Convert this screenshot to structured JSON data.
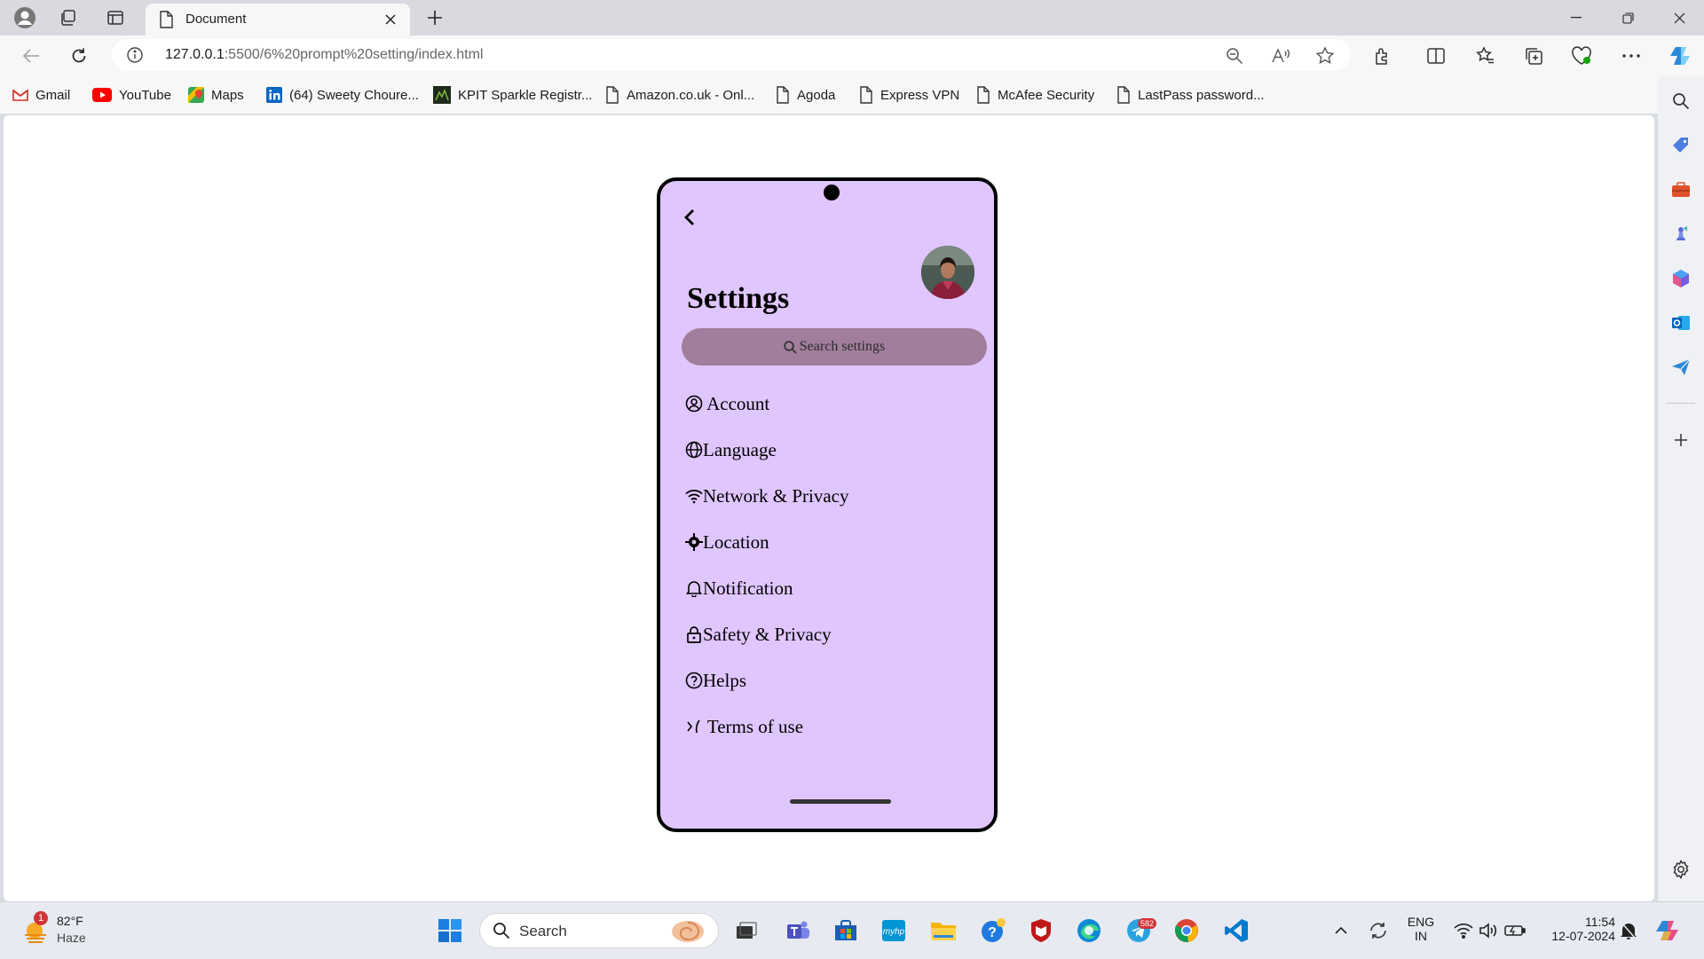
{
  "browser": {
    "tab_title": "Document",
    "url_host": "127.0.0.1",
    "url_rest": ":5500/6%20prompt%20setting/index.html"
  },
  "bookmarks": [
    {
      "label": "Gmail",
      "icon": "gmail-icon"
    },
    {
      "label": "YouTube",
      "icon": "youtube-icon"
    },
    {
      "label": "Maps",
      "icon": "maps-icon"
    },
    {
      "label": "(64) Sweety Choure...",
      "icon": "linkedin-icon"
    },
    {
      "label": "KPIT Sparkle Registr...",
      "icon": "kpit-icon"
    },
    {
      "label": "Amazon.co.uk - Onl...",
      "icon": "page-icon"
    },
    {
      "label": "Agoda",
      "icon": "page-icon"
    },
    {
      "label": "Express VPN",
      "icon": "page-icon"
    },
    {
      "label": "McAfee Security",
      "icon": "page-icon"
    },
    {
      "label": "LastPass password...",
      "icon": "page-icon"
    }
  ],
  "app": {
    "title": "Settings",
    "search_placeholder": "Search settings",
    "menu": [
      {
        "label": " Account",
        "icon": "account-circle-icon"
      },
      {
        "label": "Language",
        "icon": "globe-icon"
      },
      {
        "label": "Network & Privacy",
        "icon": "wifi-icon"
      },
      {
        "label": "Location",
        "icon": "location-crosshair-icon"
      },
      {
        "label": "Notification",
        "icon": "bell-icon"
      },
      {
        "label": "Safety & Privacy",
        "icon": "lock-icon"
      },
      {
        "label": "Helps",
        "icon": "help-circle-icon"
      },
      {
        "label": " Terms of use",
        "icon": "terms-icon"
      }
    ],
    "colors": {
      "phone_bg": "#e0c6ff",
      "search_bg": "#a07e9c"
    }
  },
  "taskbar": {
    "weather_temp": "82°F",
    "weather_cond": "Haze",
    "weather_badge": "1",
    "search_label": "Search",
    "telegram_count": "582",
    "lang_top": "ENG",
    "lang_bottom": "IN",
    "time": "11:54",
    "date": "12-07-2024"
  }
}
